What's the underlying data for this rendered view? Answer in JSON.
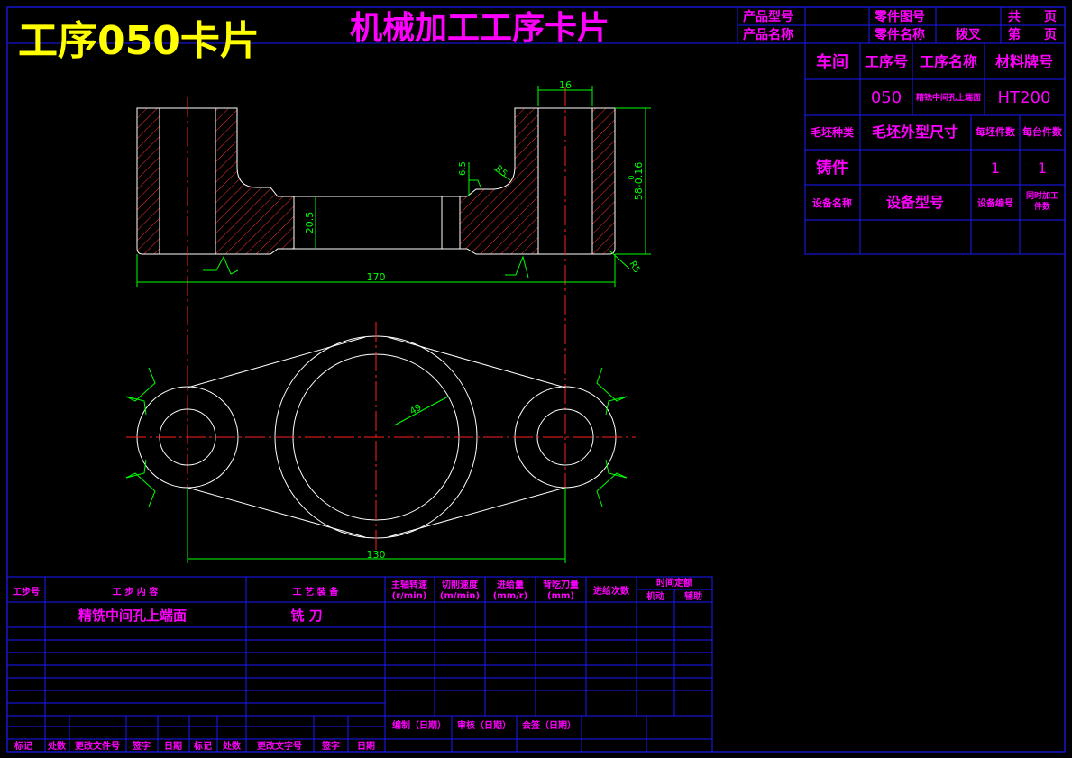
{
  "colors": {
    "background": "#000000",
    "frame": "#1a1aff",
    "label": "#ff00ff",
    "title": "#ffff00",
    "outline": "#ffffff",
    "center_line": "#ff2020",
    "dimension": "#00ff00",
    "hatch": "#ff3030"
  },
  "header": {
    "big_title": "工序050卡片",
    "card_title": "机械加工工序卡片",
    "product_model_label": "产品型号",
    "product_name_label": "产品名称",
    "part_drawing_no_label": "零件图号",
    "part_name_label": "零件名称",
    "part_name_value": "拨叉",
    "total_label": "共",
    "page_label": "页",
    "sheet_label": "第",
    "sheet_page_label": "页"
  },
  "info": {
    "workshop_label": "车间",
    "op_no_label": "工序号",
    "op_name_label": "工序名称",
    "material_label": "材料牌号",
    "op_no": "050",
    "op_name": "精铣中间孔上端面",
    "material": "HT200",
    "blank_type_label": "毛坯种类",
    "blank_size_label": "毛坯外型尺寸",
    "per_blank_label": "每坯件数",
    "per_unit_label": "每台件数",
    "blank_type": "铸件",
    "per_blank": "1",
    "per_unit": "1",
    "equip_name_label": "设备名称",
    "equip_model_label": "设备型号",
    "equip_no_label": "设备编号",
    "simul_label_1": "同时加工",
    "simul_label_2": "件数"
  },
  "dimensions": {
    "top_width": "16",
    "height_tol": "58-0.16",
    "height_tol_upper": "0",
    "r5_a": "R5",
    "depth_65": "6.5",
    "thickness_205": "20.5",
    "r5_b": "R5",
    "overall_length": "170",
    "radius_49": "49",
    "center_distance": "130"
  },
  "process": {
    "step_no_label": "工步号",
    "step_content_label": "工 步 内 容",
    "equipment_label": "工 艺 装 备",
    "spindle_label_1": "主轴转速",
    "spindle_label_2": "(r/min)",
    "cut_speed_label_1": "切削速度",
    "cut_speed_label_2": "(m/min)",
    "feed_label_1": "进给量",
    "feed_label_2": "(mm/r)",
    "depth_label_1": "背吃刀量",
    "depth_label_2": "(mm)",
    "passes_label": "进给次数",
    "time_label": "时间定额",
    "machine_time_label": "机动",
    "aux_time_label": "辅助",
    "step_content": "精铣中间孔上端面",
    "equipment": "铣 刀"
  },
  "footer": {
    "compile_label": "编制（日期）",
    "review_label": "审核（日期）",
    "approve_label": "会签（日期）",
    "mark_label": "标记",
    "count_label": "处数",
    "change_doc_label": "更改文件号",
    "sign_label": "签字",
    "date_label": "日期",
    "mark_label_2": "标记",
    "count_label_2": "处数",
    "change_doc_label_2": "更改文字号",
    "sign_label_2": "签字",
    "date_label_2": "日期"
  }
}
